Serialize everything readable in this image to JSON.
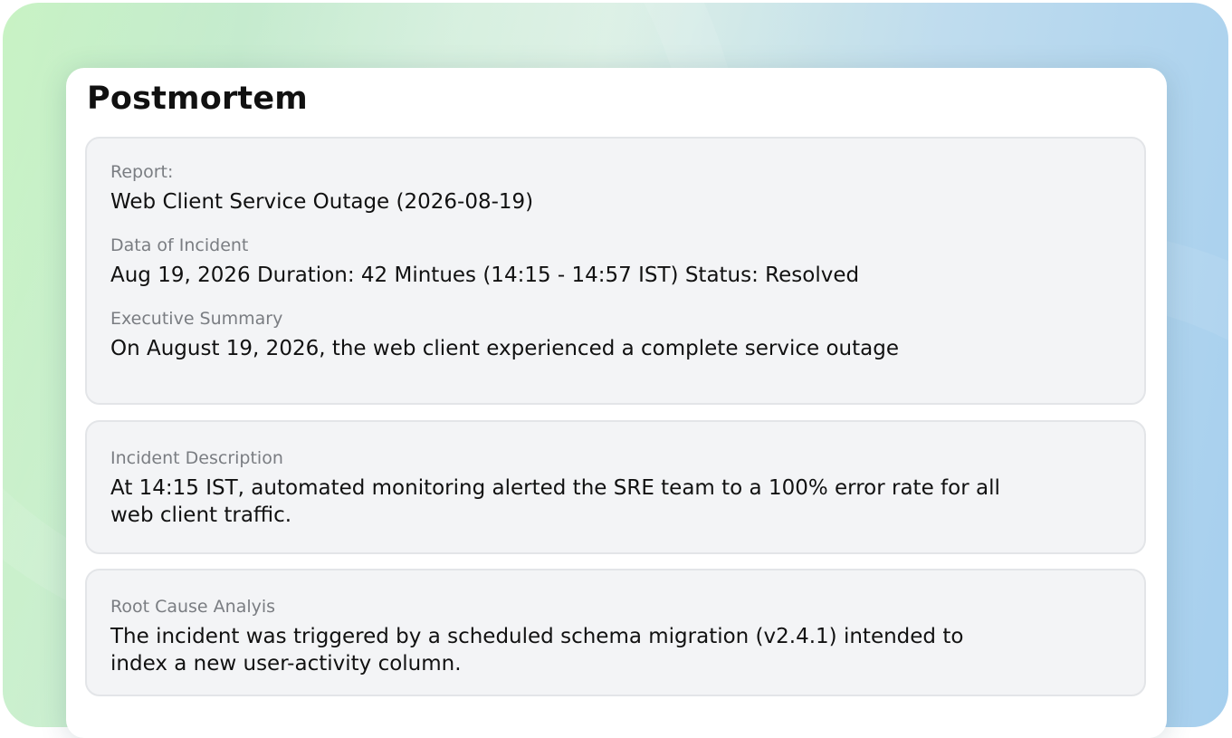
{
  "page": {
    "title": "Postmortem"
  },
  "report": {
    "report_label": "Report:",
    "report_value": "Web Client Service Outage (2026-08-19)",
    "date_label": "Data of Incident",
    "date_value": "Aug 19, 2026 Duration: 42 Mintues (14:15 - 14:57 IST) Status: Resolved",
    "summary_label": "Executive Summary",
    "summary_value": "On August 19, 2026, the web client experienced a complete service outage"
  },
  "incident": {
    "label": "Incident Description",
    "value": "At 14:15 IST, automated monitoring alerted the SRE team to a 100% error rate for all web client traffic."
  },
  "root_cause": {
    "label": "Root Cause Analyis",
    "value": "The incident was triggered by a scheduled schema migration (v2.4.1) intended to index a new user-activity column."
  },
  "colors": {
    "card_background": "#f3f4f6",
    "card_border": "#e3e5e8",
    "label_text": "#7a7d82",
    "value_text": "#111111"
  }
}
